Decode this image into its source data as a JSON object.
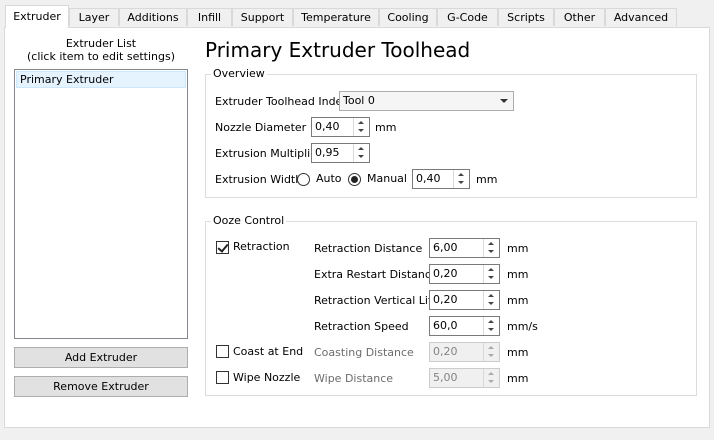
{
  "tabs": [
    "Extruder",
    "Layer",
    "Additions",
    "Infill",
    "Support",
    "Temperature",
    "Cooling",
    "G-Code",
    "Scripts",
    "Other",
    "Advanced"
  ],
  "active_tab": "Extruder",
  "sidebar": {
    "list_heading_line1": "Extruder List",
    "list_heading_line2": "(click item to edit settings)",
    "items": [
      "Primary Extruder"
    ],
    "add_button": "Add Extruder",
    "remove_button": "Remove Extruder"
  },
  "main": {
    "title": "Primary Extruder Toolhead",
    "overview": {
      "title": "Overview",
      "toolhead_index_label": "Extruder Toolhead Index",
      "toolhead_index_value": "Tool 0",
      "nozzle_label": "Nozzle Diameter",
      "nozzle_value": "0,40",
      "nozzle_unit": "mm",
      "multiplier_label": "Extrusion Multiplier",
      "multiplier_value": "0,95",
      "width_label": "Extrusion Width",
      "width_auto": "Auto",
      "width_manual": "Manual",
      "width_mode": "Manual",
      "width_value": "0,40",
      "width_unit": "mm"
    },
    "ooze": {
      "title": "Ooze Control",
      "retraction_label": "Retraction",
      "retraction_checked": true,
      "coast_label": "Coast at End",
      "coast_checked": false,
      "wipe_label": "Wipe Nozzle",
      "wipe_checked": false,
      "rows": [
        {
          "label": "Retraction Distance",
          "value": "6,00",
          "unit": "mm",
          "enabled": true
        },
        {
          "label": "Extra Restart Distance",
          "value": "0,20",
          "unit": "mm",
          "enabled": true
        },
        {
          "label": "Retraction Vertical Lift",
          "value": "0,20",
          "unit": "mm",
          "enabled": true
        },
        {
          "label": "Retraction Speed",
          "value": "60,0",
          "unit": "mm/s",
          "enabled": true
        },
        {
          "label": "Coasting Distance",
          "value": "0,20",
          "unit": "mm",
          "enabled": false
        },
        {
          "label": "Wipe Distance",
          "value": "5,00",
          "unit": "mm",
          "enabled": false
        }
      ]
    }
  }
}
